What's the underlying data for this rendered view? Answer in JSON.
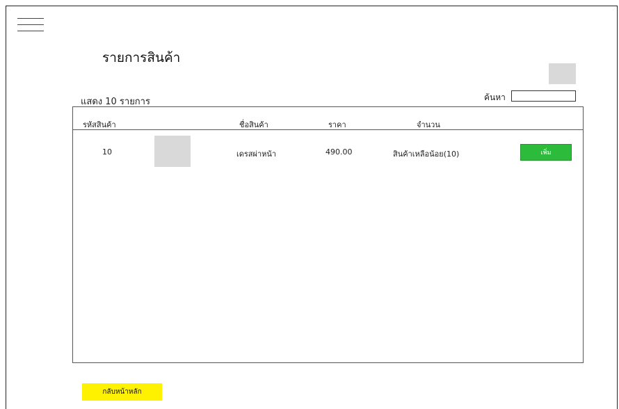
{
  "header": {
    "menu_icon": "hamburger-menu-icon",
    "title": "รายการสินค้า",
    "avatar": "user-avatar-placeholder"
  },
  "toolbar": {
    "show_count": "แสดง 10 รายการ",
    "search_label": "ค้นหา",
    "search_value": "",
    "search_placeholder": ""
  },
  "table": {
    "columns": [
      "รหัสสินค้า",
      "ชื่อสินค้า",
      "ราคา",
      "จำนวน"
    ],
    "rows": [
      {
        "id": "10",
        "image": "product-image-placeholder",
        "name": "เดรสผ่าหน้า",
        "price": "490.00",
        "quantity": "สินค้าเหลือน้อย(10)",
        "action": "เพิ่ม"
      }
    ]
  },
  "footer": {
    "back_label": "กลับหน้าหลัก"
  },
  "colors": {
    "add_button": "#2dbb3c",
    "back_button": "#fff200",
    "placeholder": "#d9d9d9"
  }
}
